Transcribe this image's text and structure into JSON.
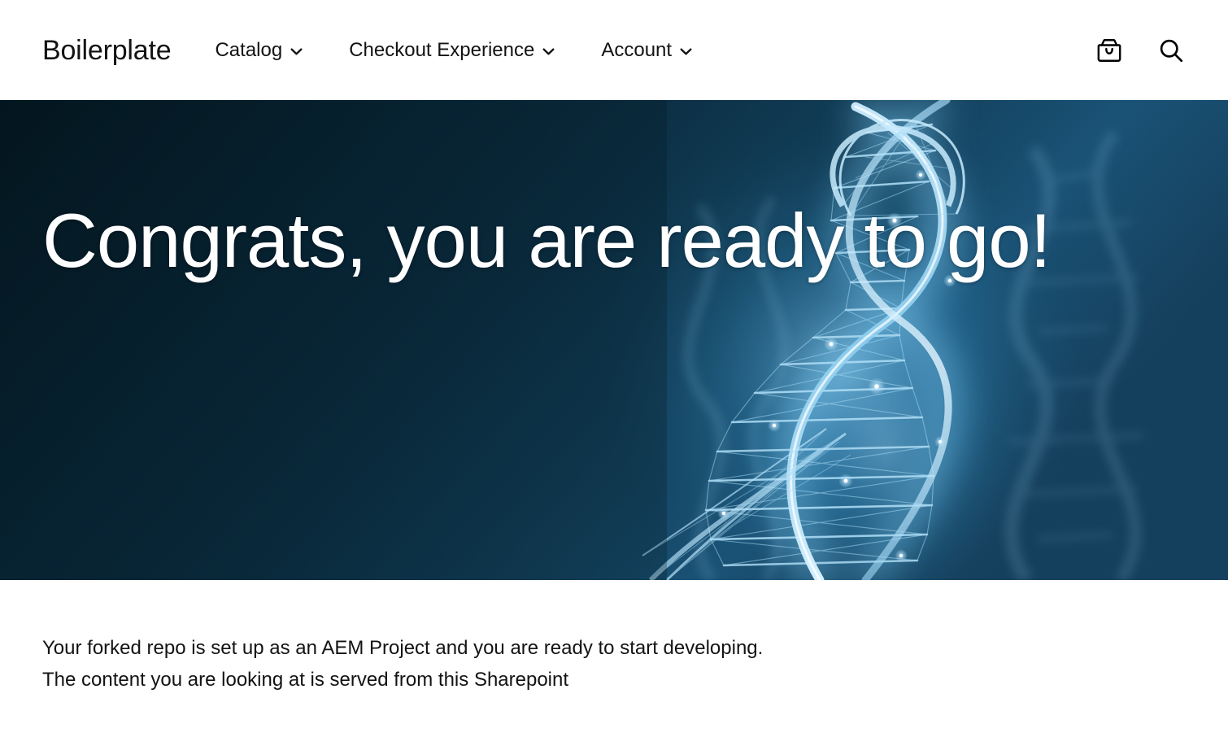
{
  "header": {
    "brand": "Boilerplate",
    "nav": [
      {
        "label": "Catalog",
        "icon": "chevron-down-icon",
        "has_dropdown": true
      },
      {
        "label": "Checkout Experience",
        "icon": "chevron-down-icon",
        "has_dropdown": true
      },
      {
        "label": "Account",
        "icon": "chevron-down-icon",
        "has_dropdown": true
      }
    ],
    "actions": [
      {
        "name": "cart-icon",
        "label": "Cart"
      },
      {
        "name": "search-icon",
        "label": "Search"
      }
    ],
    "background": "#ffffff",
    "text_color": "#131313"
  },
  "hero": {
    "title": "Congrats, you are ready to go!",
    "image_alt": "Glowing blue wireframe DNA double helix on a dark navy background",
    "title_color": "#ffffff",
    "bg_dark": "#071d2b",
    "bg_mid": "#10425f",
    "bg_light": "#1d5c80",
    "strand_color": "#bfe4f7",
    "glow_color": "#6fc3ef"
  },
  "main": {
    "paragraphs": [
      {
        "before": "The content you are looking at is served from this ",
        "link": "Sharepoint",
        "after": ""
      }
    ],
    "line1": "Your forked repo is set up as an AEM Project and you are ready to start developing.",
    "line2_before": "The content you are looking at is served from this ",
    "line2_link": "Sharepoint"
  }
}
